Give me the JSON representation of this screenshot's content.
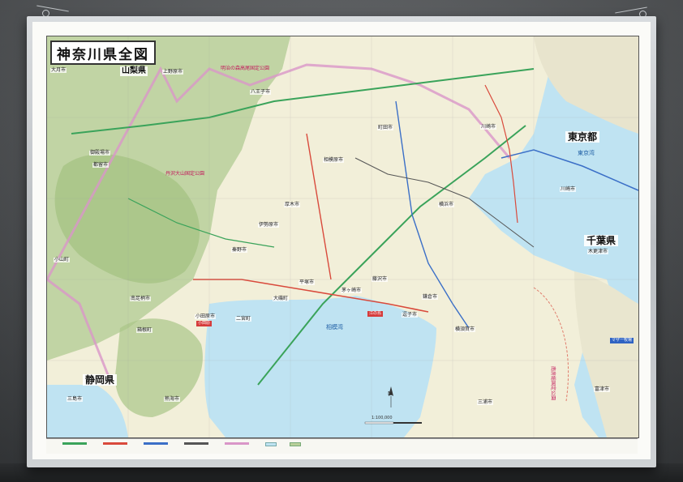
{
  "map": {
    "title": "神奈川県全図",
    "prefectures": {
      "yamanashi": "山梨県",
      "tokyo": "東京都",
      "chiba": "千葉県",
      "shizuoka": "静岡県"
    },
    "seas": {
      "tokyo_bay": "東京湾",
      "sagami_bay": "相模湾"
    },
    "parks": {
      "tanzawa": "丹沢大山国定公園",
      "meiji": "明治の森高尾国定公園",
      "minami_boso": "南房総国定公園"
    },
    "cities": [
      {
        "key": "otsuki",
        "name": "大月市"
      },
      {
        "key": "uenohara",
        "name": "上野原市"
      },
      {
        "key": "hachioji",
        "name": "八王子市"
      },
      {
        "key": "machida",
        "name": "町田市"
      },
      {
        "key": "sagamihara",
        "name": "相模原市"
      },
      {
        "key": "atsugi",
        "name": "厚木市"
      },
      {
        "key": "isehara",
        "name": "伊勢原市"
      },
      {
        "key": "hiratsuka",
        "name": "平塚市"
      },
      {
        "key": "chigasaki",
        "name": "茅ヶ崎市"
      },
      {
        "key": "fujisawa",
        "name": "藤沢市"
      },
      {
        "key": "kamakura",
        "name": "鎌倉市"
      },
      {
        "key": "zushi",
        "name": "逗子市"
      },
      {
        "key": "yokosuka",
        "name": "横須賀市"
      },
      {
        "key": "miura",
        "name": "三浦市"
      },
      {
        "key": "yokohama",
        "name": "横浜市"
      },
      {
        "key": "kawasaki",
        "name": "川崎市"
      },
      {
        "key": "odawara",
        "name": "小田原市"
      },
      {
        "key": "ninomiya",
        "name": "二宮町"
      },
      {
        "key": "oiso",
        "name": "大磯町"
      },
      {
        "key": "hadano",
        "name": "秦野市"
      },
      {
        "key": "minamiashigara",
        "name": "南足柄市"
      },
      {
        "key": "hakone",
        "name": "箱根町"
      },
      {
        "key": "atami",
        "name": "熱海市"
      },
      {
        "key": "mishima",
        "name": "三島市"
      },
      {
        "key": "gotemba",
        "name": "御殿場市"
      },
      {
        "key": "oyama",
        "name": "小山町"
      },
      {
        "key": "tsuru",
        "name": "都留市"
      },
      {
        "key": "kisarazu",
        "name": "木更津市"
      },
      {
        "key": "kawasaki_chiba",
        "name": "川崎市"
      },
      {
        "key": "futtsu",
        "name": "富津市"
      }
    ],
    "scale_text": "1:100,000",
    "compass": "N",
    "tags": {
      "t1": "小田原",
      "t2": "江の島",
      "t3": "マザー牧場"
    }
  },
  "colors": {
    "sea": "#bfe3f2",
    "land": "#f2efd9",
    "mountain": "#b9cf9a",
    "road_green": "#3aa35a",
    "road_red": "#d94a3c",
    "road_blue": "#3b6fc7",
    "border_pink": "#d996c8"
  }
}
